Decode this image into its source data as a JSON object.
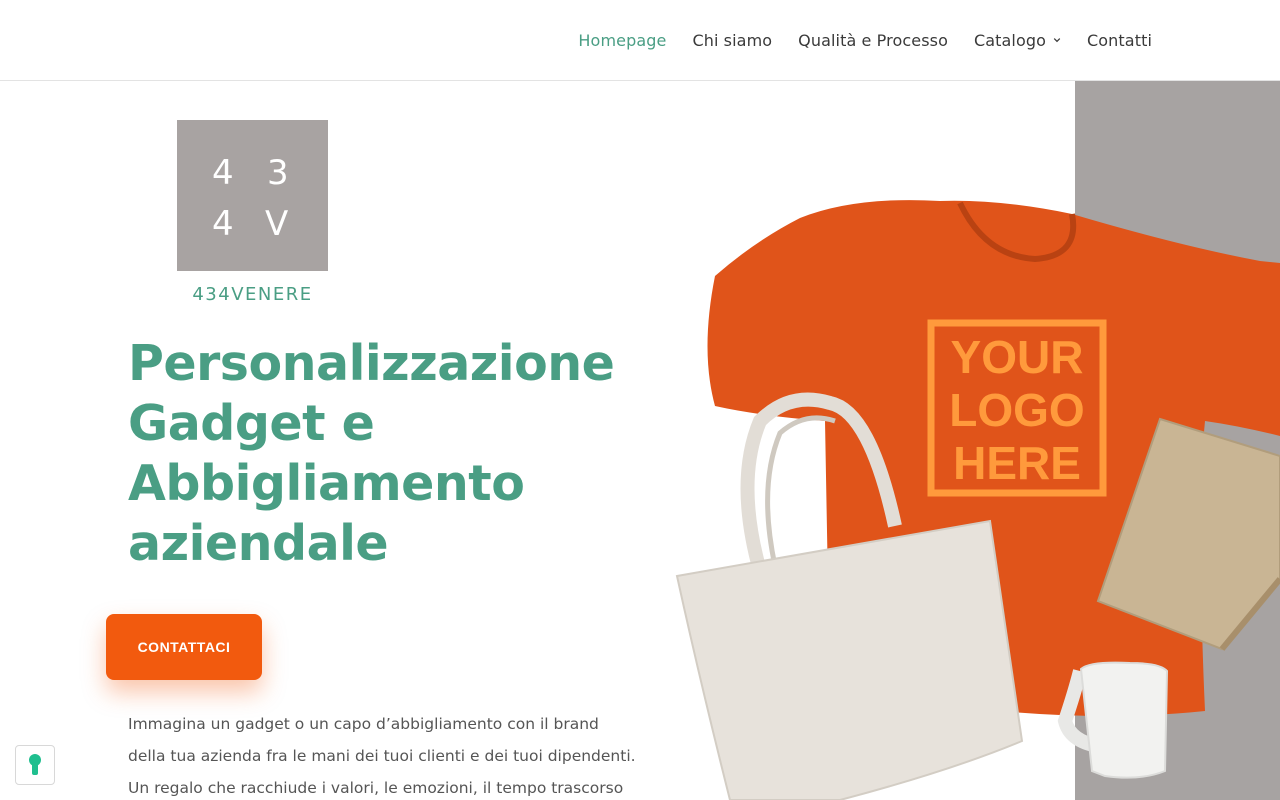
{
  "nav": {
    "items": [
      {
        "label": "Homepage",
        "active": true
      },
      {
        "label": "Chi siamo",
        "active": false
      },
      {
        "label": "Qualità e Processo",
        "active": false
      },
      {
        "label": "Catalogo",
        "active": false,
        "has_dropdown": true
      },
      {
        "label": "Contatti",
        "active": false
      }
    ]
  },
  "logo": {
    "chars": [
      "4",
      "3",
      "4",
      "V"
    ],
    "name": "434VENERE"
  },
  "hero": {
    "headline_lines": [
      "Personalizzazione",
      "Gadget e",
      "Abbigliamento",
      "aziendale"
    ],
    "cta_label": "CONTATTACI",
    "paragraph_lines": [
      "Immagina un gadget o un capo d’abbigliamento con il brand",
      "della tua azienda fra le mani dei tuoi clienti e dei tuoi dipendenti.",
      "Un regalo che racchiude i valori, le emozioni, il tempo trascorso"
    ]
  },
  "product_image": {
    "tshirt_print_lines": [
      "YOUR",
      "LOGO",
      "HERE"
    ]
  },
  "colors": {
    "accent_green": "#4a9e84",
    "cta_orange": "#f25a0e",
    "logo_grey": "#a8a3a2",
    "tshirt_orange": "#e0541a",
    "print_orange": "#ff9a3c"
  },
  "icons": {
    "cookie_badge": "keyhole-icon",
    "dropdown": "chevron-down-icon"
  }
}
